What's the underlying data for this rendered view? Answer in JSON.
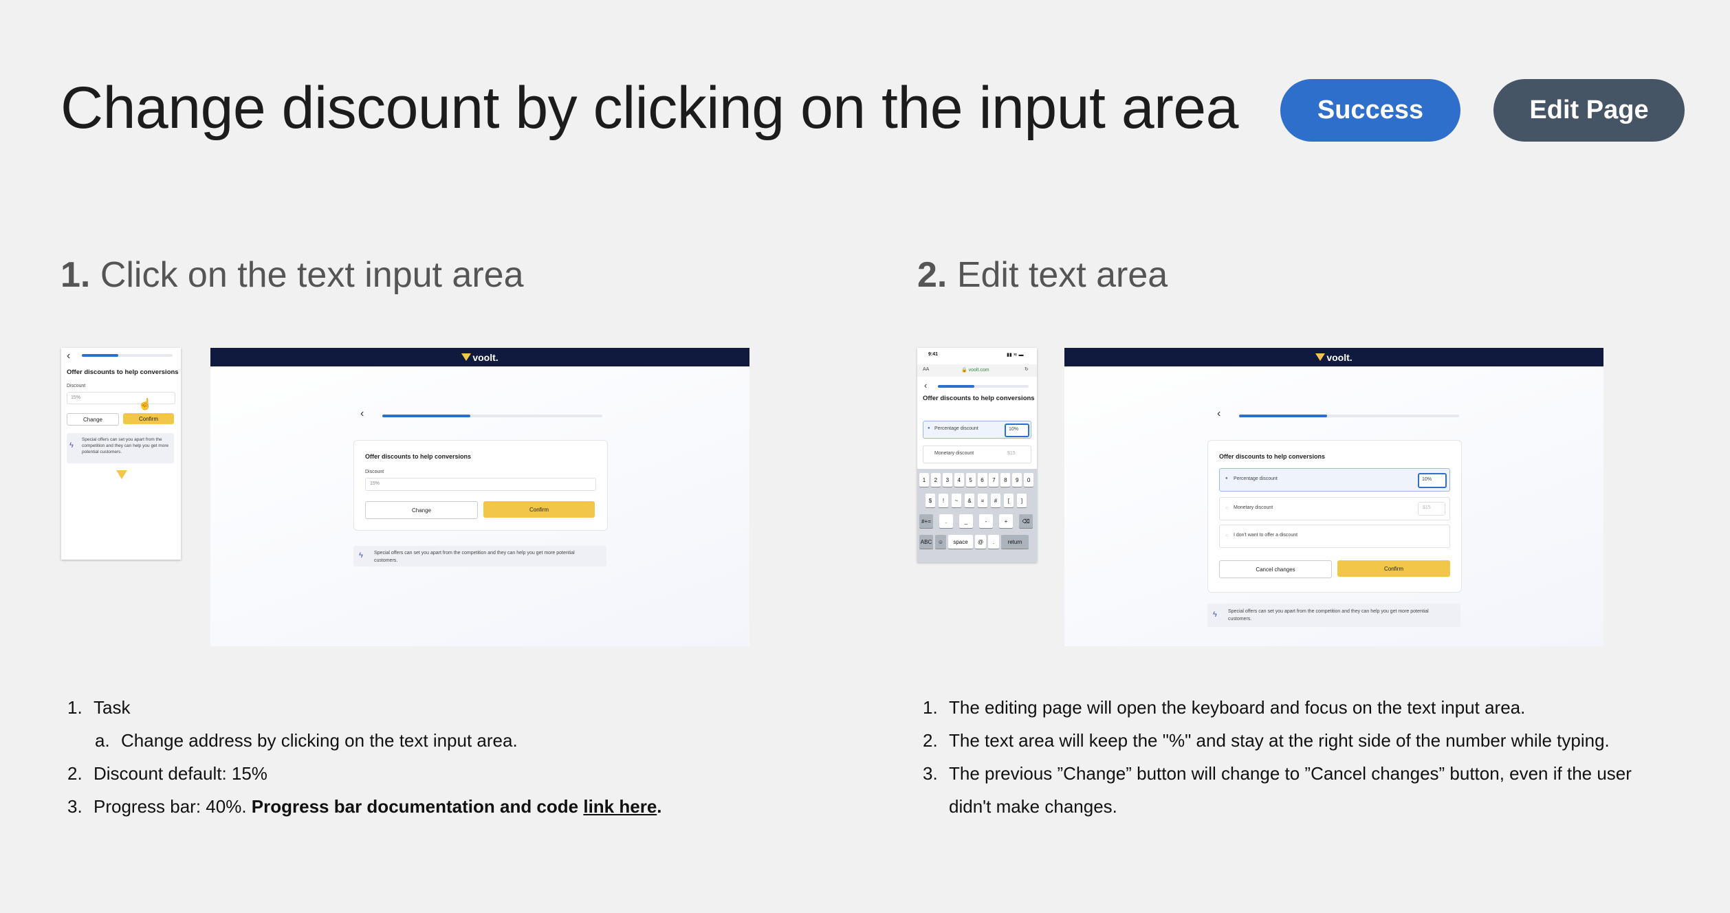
{
  "header": {
    "title": "Change discount by clicking on the input area",
    "success_label": "Success",
    "edit_label": "Edit Page"
  },
  "step1": {
    "number": "1.",
    "title": "Click on the text input area",
    "mobile": {
      "heading": "Offer discounts to help conversions",
      "discount_label": "Discount",
      "discount_value": "15%",
      "change_label": "Change",
      "confirm_label": "Confirm",
      "tip": "Special offers can set you apart from the competition and they can help you get more potential customers.",
      "progress": 0.4
    },
    "desktop": {
      "brand": "voolt.",
      "heading": "Offer discounts to help conversions",
      "discount_label": "Discount",
      "discount_value": "15%",
      "change_label": "Change",
      "confirm_label": "Confirm",
      "tip": "Special offers can set you apart from the competition and they can help you get more potential customers.",
      "progress": 0.4
    },
    "notes": {
      "n1": "1.",
      "task": "Task",
      "na": "a.",
      "task_a": "Change address by clicking on the text input area.",
      "n2": "2.",
      "default": "Discount default: 15%",
      "n3": "3.",
      "progress_text": "Progress bar: 40%.",
      "progress_bold": "Progress bar documentation and code",
      "link": "link here",
      "period": "."
    }
  },
  "step2": {
    "number": "2.",
    "title": "Edit text area",
    "mobile": {
      "time": "9:41",
      "aa": "AA",
      "url": "voolt.com",
      "heading": "Offer discounts to help conversions",
      "pct_label": "Percentage discount",
      "pct_value": "10%",
      "mon_label": "Monetary discount",
      "mon_value": "$15",
      "progress": 0.4,
      "keys_row1": [
        "1",
        "2",
        "3",
        "4",
        "5",
        "6",
        "7",
        "8",
        "9",
        "0"
      ],
      "keys_row2": [
        "$",
        "!",
        "~",
        "&",
        "=",
        "#",
        "[",
        "]"
      ],
      "keys_row3": [
        "#+=",
        ".",
        "_",
        "-",
        "+",
        "⌫"
      ],
      "keys_row4": [
        "ABC",
        "☺",
        "space",
        "@",
        ".",
        "return"
      ]
    },
    "desktop": {
      "brand": "voolt.",
      "heading": "Offer discounts to help conversions",
      "pct_label": "Percentage discount",
      "pct_value": "10%",
      "mon_label": "Monetary discount",
      "mon_value": "$15",
      "none_label": "I don't want to offer a discount",
      "cancel_label": "Cancel changes",
      "confirm_label": "Confirm",
      "tip": "Special offers can set you apart from the competition and they can help you get more potential customers.",
      "progress": 0.4
    },
    "notes": {
      "n1": "1.",
      "l1": "The editing page will open the keyboard and focus on the text input area.",
      "n2": "2.",
      "l2": "The text area will keep the \"%\" and stay at the right side of the number while typing.",
      "n3": "3.",
      "l3a": "The previous ”Change” button will change to ”Cancel changes” button, even if the user",
      "l3b": "didn't make changes."
    }
  }
}
